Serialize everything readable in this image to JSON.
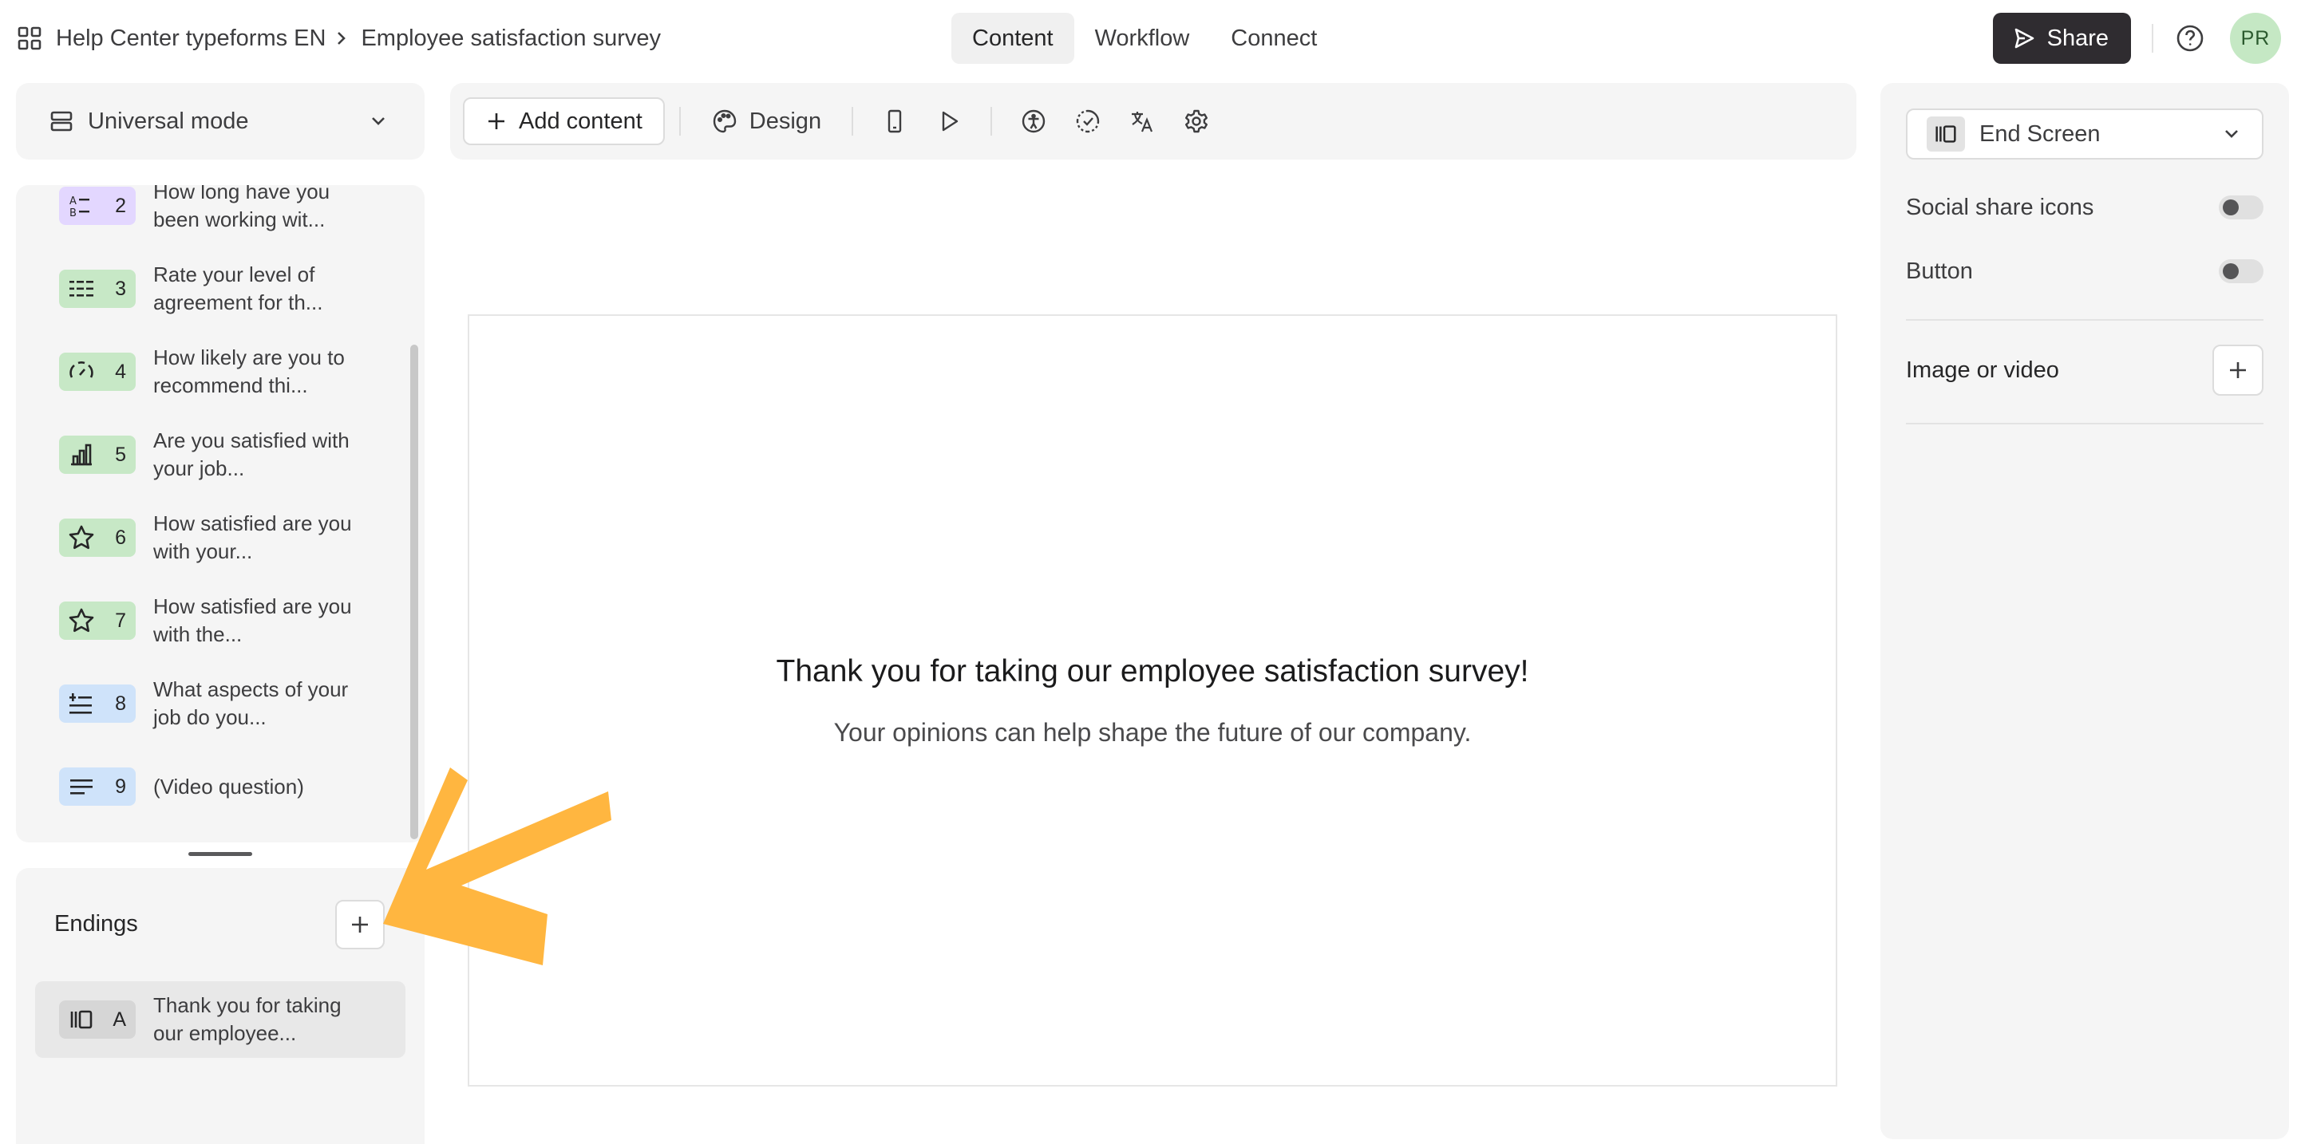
{
  "breadcrumb": {
    "workspace": "Help Center typeforms EN",
    "form": "Employee satisfaction survey"
  },
  "tabs": [
    {
      "label": "Content",
      "active": true
    },
    {
      "label": "Workflow",
      "active": false
    },
    {
      "label": "Connect",
      "active": false
    }
  ],
  "header": {
    "share_label": "Share",
    "avatar_initials": "PR"
  },
  "left": {
    "mode_label": "Universal mode",
    "questions": [
      {
        "number": "2",
        "text": "How long have you been working wit...",
        "icon": "multiple-choice-icon",
        "color": "#e3d7ff"
      },
      {
        "number": "3",
        "text": "Rate your level of agreement for th...",
        "icon": "matrix-icon",
        "color": "#c7e8c6"
      },
      {
        "number": "4",
        "text": "How likely are you to recommend thi...",
        "icon": "gauge-icon",
        "color": "#c7e8c6"
      },
      {
        "number": "5",
        "text": "Are you satisfied with your job...",
        "icon": "bar-chart-icon",
        "color": "#c7e8c6"
      },
      {
        "number": "6",
        "text": "How satisfied are you with your...",
        "icon": "star-icon",
        "color": "#c7e8c6"
      },
      {
        "number": "7",
        "text": "How satisfied are you with the...",
        "icon": "star-icon",
        "color": "#c7e8c6"
      },
      {
        "number": "8",
        "text": "What aspects of your job do you...",
        "icon": "ranking-icon",
        "color": "#cfe3fa"
      },
      {
        "number": "9",
        "text": "(Video question)",
        "icon": "long-text-icon",
        "color": "#cfe3fa"
      }
    ],
    "endings_title": "Endings",
    "ending_item": {
      "letter": "A",
      "text": "Thank you for taking our employee..."
    }
  },
  "toolbar": {
    "add_content_label": "Add content",
    "design_label": "Design"
  },
  "preview": {
    "title": "Thank you for taking our employee satisfaction survey!",
    "subtitle": "Your opinions can help shape the future of our company."
  },
  "right": {
    "screen_type": "End Screen",
    "social_share_label": "Social share icons",
    "social_share_on": false,
    "button_label": "Button",
    "button_on": false,
    "media_label": "Image or video"
  },
  "colors": {
    "accent_dark": "#2f2c30",
    "arrow": "#ffb640",
    "avatar_bg": "#c5e8c4"
  }
}
